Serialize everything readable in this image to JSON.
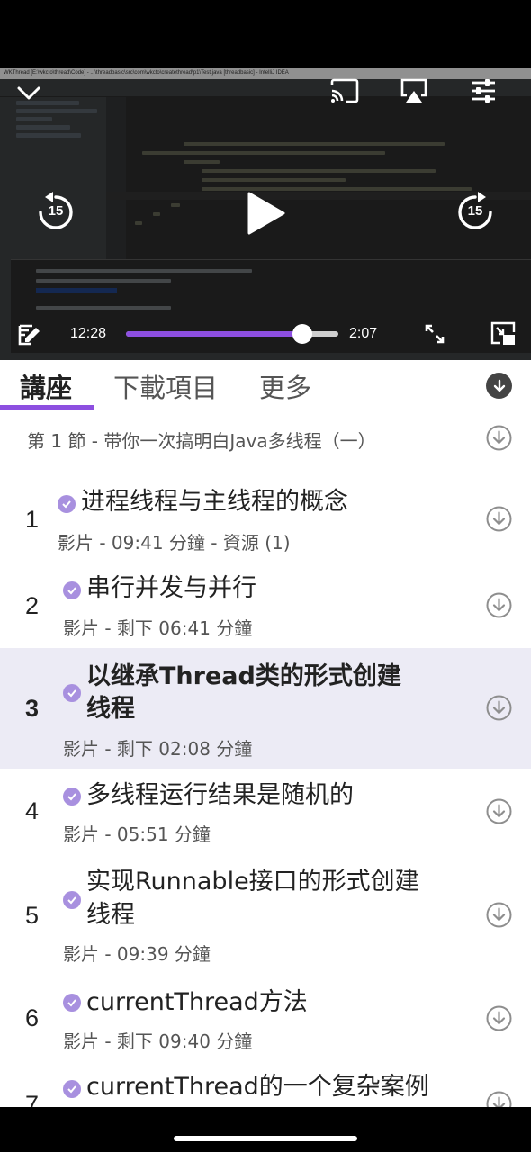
{
  "player": {
    "ide_window_title": "WKThread [E:\\wkcto\\thread\\Code] - ...\\threadbasic\\src\\com\\wkcto\\createthread\\p1\\Test.java [threadbasic] - IntelliJ IDEA",
    "current_time": "12:28",
    "remaining_time": "2:07",
    "progress_fraction": 0.83,
    "skip_back_seconds": "15",
    "skip_forward_seconds": "15",
    "accent_color": "#8d4fe0"
  },
  "tabs": [
    {
      "label": "講座",
      "active": true
    },
    {
      "label": "下載項目",
      "active": false
    },
    {
      "label": "更多",
      "active": false
    }
  ],
  "section": {
    "title": "第 1 節 - 带你一次搞明白Java多线程（一）"
  },
  "lectures": [
    {
      "number": "1",
      "title_lines": [
        "进程线程与主线程的概念"
      ],
      "subtitle": "影片 - 09:41 分鐘 - 資源 (1)",
      "current": false
    },
    {
      "number": "2",
      "title_lines": [
        "串行并发与并行"
      ],
      "subtitle": "影片 - 剩下 06:41 分鐘",
      "current": false
    },
    {
      "number": "3",
      "title_lines": [
        "以继承Thread类的形式创建",
        "线程"
      ],
      "subtitle": "影片 - 剩下 02:08 分鐘",
      "current": true
    },
    {
      "number": "4",
      "title_lines": [
        "多线程运行结果是随机的"
      ],
      "subtitle": "影片 - 05:51 分鐘",
      "current": false
    },
    {
      "number": "5",
      "title_lines": [
        "实现Runnable接口的形式创建",
        "线程"
      ],
      "subtitle": "影片 - 09:39 分鐘",
      "current": false
    },
    {
      "number": "6",
      "title_lines": [
        "currentThread方法"
      ],
      "subtitle": "影片 - 剩下 09:40 分鐘",
      "current": false
    },
    {
      "number": "7",
      "title_lines": [
        "currentThread的一个复杂案例"
      ],
      "subtitle": "",
      "current": false
    }
  ]
}
